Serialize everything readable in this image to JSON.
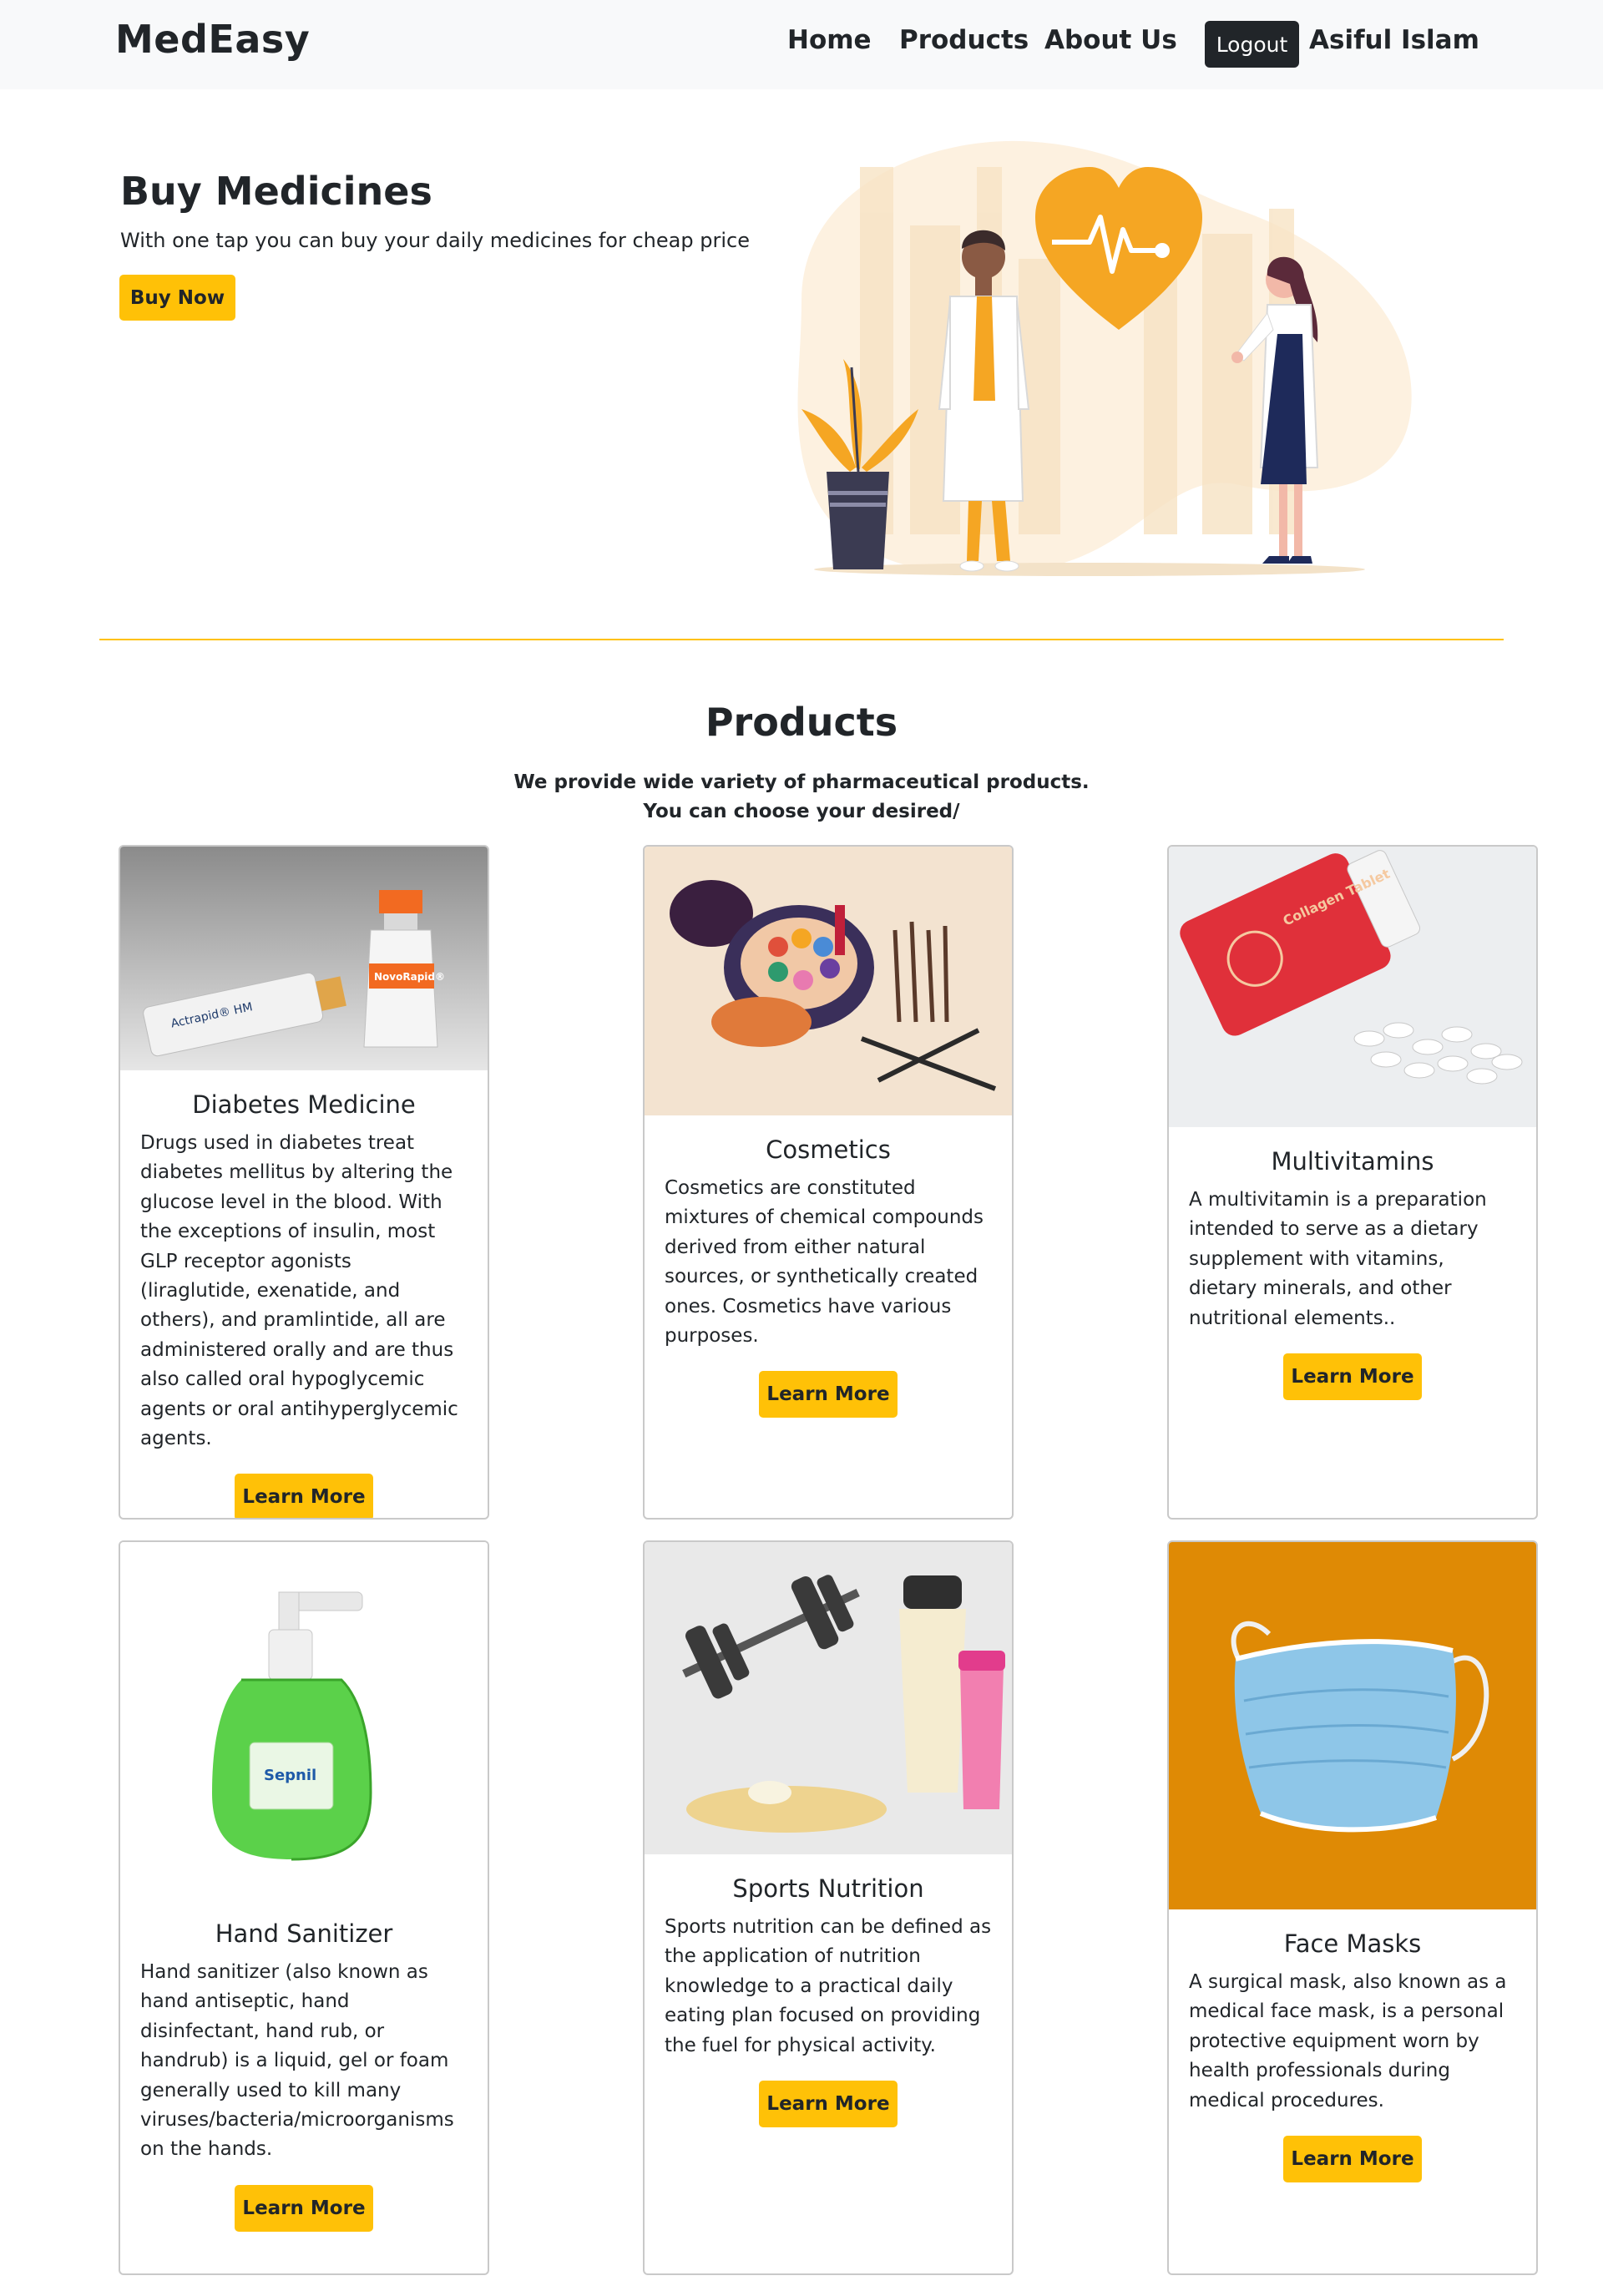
{
  "nav": {
    "brand": "MedEasy",
    "links": [
      {
        "label": "Home"
      },
      {
        "label": "Products"
      },
      {
        "label": "About Us"
      }
    ],
    "logout_label": "Logout",
    "user_name": "Asiful Islam"
  },
  "hero": {
    "title": "Buy Medicines",
    "subtitle": "With one tap you can buy your daily medicines for cheap price",
    "button_label": "Buy Now"
  },
  "products": {
    "title": "Products",
    "subtitle_line1": "We provide wide variety of pharmaceutical products.",
    "subtitle_line2": "You can choose your desired/",
    "items": [
      {
        "name": "Diabetes Medicine",
        "description": "Drugs used in diabetes treat diabetes mellitus by altering the glucose level in the blood. With the exceptions of insulin, most GLP receptor agonists (liraglutide, exenatide, and others), and pramlintide, all are administered orally and are thus also called oral hypoglycemic agents or oral antihyperglycemic agents.",
        "button_label": "Learn More",
        "img_label_1": "Actrapid® HM",
        "img_label_2": "NovoRapid®"
      },
      {
        "name": "Cosmetics",
        "description": "Cosmetics are constituted mixtures of chemical compounds derived from either natural sources, or synthetically created ones. Cosmetics have various purposes.",
        "button_label": "Learn More"
      },
      {
        "name": "Multivitamins",
        "description": "A multivitamin is a preparation intended to serve as a dietary supplement with vitamins, dietary minerals, and other nutritional elements..",
        "button_label": "Learn More",
        "img_label_1": "Collagen Tablet"
      },
      {
        "name": "Hand Sanitizer",
        "description": "Hand sanitizer (also known as hand antiseptic, hand disinfectant, hand rub, or handrub) is a liquid, gel or foam generally used to kill many viruses/bacteria/microorganisms on the hands.",
        "button_label": "Learn More",
        "img_label_1": "Sepnil"
      },
      {
        "name": "Sports Nutrition",
        "description": "Sports nutrition can be defined as the application of nutrition knowledge to a practical daily eating plan focused on providing the fuel for physical activity.",
        "button_label": "Learn More"
      },
      {
        "name": "Face Masks",
        "description": "A surgical mask, also known as a medical face mask, is a personal protective equipment worn by health professionals during medical procedures.",
        "button_label": "Learn More"
      }
    ]
  },
  "colors": {
    "accent": "#ffc107",
    "navbar_bg": "#f8f9fa",
    "dark": "#212529",
    "illustration_orange": "#f5a623",
    "mask_bg": "#df8a05"
  }
}
